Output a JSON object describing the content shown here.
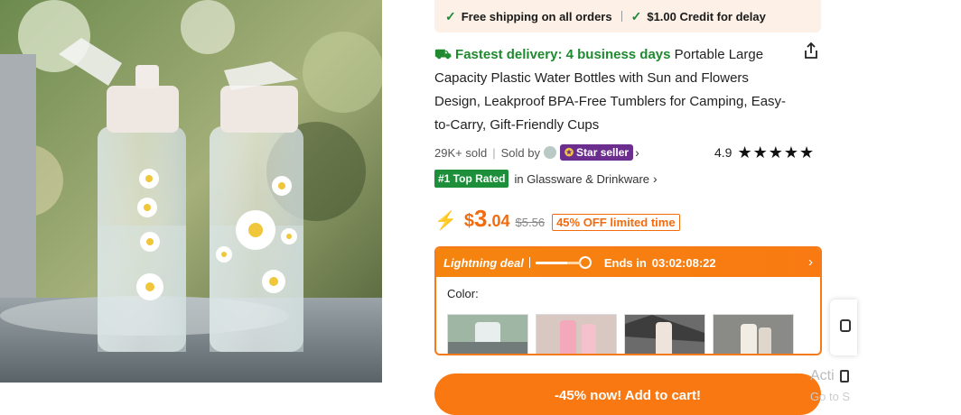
{
  "shipping_banner": {
    "item1": "Free shipping on all orders",
    "item2": "$1.00 Credit for delay"
  },
  "product": {
    "delivery_label": "Fastest delivery: 4 business days",
    "title": "Portable Large Capacity Plastic Water Bottles with Sun and Flowers Design, Leakproof BPA-Free Tumblers for Camping, Easy-to-Carry, Gift-Friendly Cups",
    "sold_count": "29K+ sold",
    "sold_by_label": "Sold by",
    "seller_badge": "Star seller",
    "rating_value": "4.9",
    "rating_stars": "★★★★★",
    "rank_badge": "#1 Top Rated",
    "rank_category": "in Glassware & Drinkware",
    "price_currency": "$",
    "price_int": "3",
    "price_dec": ".04",
    "old_price": "$5.56",
    "discount_badge": "45% OFF limited time"
  },
  "deal": {
    "title": "Lightning deal",
    "progress": 0.7,
    "ends_label": "Ends in",
    "timer": "03:02:08:22"
  },
  "color_label": "Color:",
  "cart_button": "-45% now! Add to cart!",
  "watermark": {
    "line1": "Acti",
    "line2": "Go to S"
  },
  "colors": {
    "accent": "#f97812",
    "green": "#1f8a2f",
    "star_seller": "#6b2d8e"
  },
  "icons": [
    "check-icon",
    "truck-icon",
    "share-icon",
    "star-icon",
    "lightning-icon",
    "chevron-right-icon"
  ]
}
